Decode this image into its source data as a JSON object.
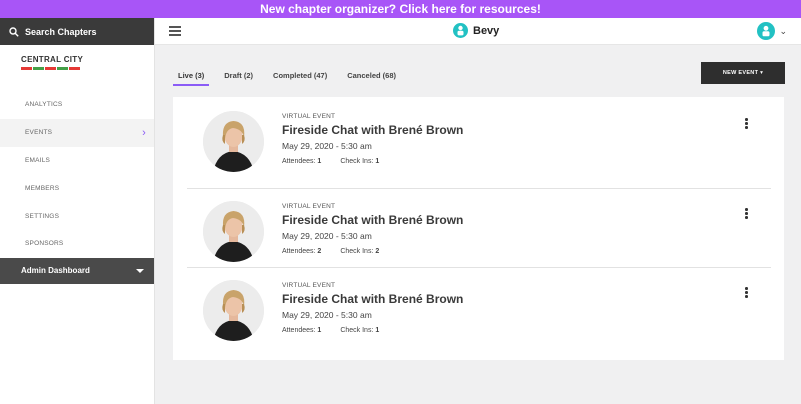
{
  "banner": {
    "text": "New chapter organizer? Click here for resources!"
  },
  "sidebar": {
    "search_label": "Search Chapters",
    "chapter_name": "CENTRAL CITY",
    "chapter_stripe_colors": [
      "#e53935",
      "#43a047",
      "#e53935",
      "#43a047",
      "#e53935"
    ],
    "items": [
      {
        "label": "ANALYTICS"
      },
      {
        "label": "EVENTS",
        "active": true
      },
      {
        "label": "EMAILS"
      },
      {
        "label": "MEMBERS"
      },
      {
        "label": "SETTINGS"
      },
      {
        "label": "SPONSORS"
      }
    ],
    "admin_label": "Admin Dashboard"
  },
  "topbar": {
    "brand": "Bevy",
    "menu_icon": "hamburger-icon",
    "user_icon": "user-avatar-icon"
  },
  "main": {
    "tabs": [
      {
        "label": "Live (3)",
        "active": true
      },
      {
        "label": "Draft (2)"
      },
      {
        "label": "Completed (47)"
      },
      {
        "label": "Canceled (68)"
      }
    ],
    "new_event_label": "NEW EVENT ▾",
    "events": [
      {
        "type": "VIRTUAL EVENT",
        "title": "Fireside Chat with Brené Brown",
        "date": "May 29, 2020 - 5:30 am",
        "attendees_label": "Attendees:",
        "attendees": "1",
        "checkins_label": "Check Ins:",
        "checkins": "1"
      },
      {
        "type": "VIRTUAL EVENT",
        "title": "Fireside Chat with Brené Brown",
        "date": "May 29, 2020 - 5:30 am",
        "attendees_label": "Attendees:",
        "attendees": "2",
        "checkins_label": "Check Ins:",
        "checkins": "2"
      },
      {
        "type": "VIRTUAL EVENT",
        "title": "Fireside Chat with Brené Brown",
        "date": "May 29, 2020 - 5:30 am",
        "attendees_label": "Attendees:",
        "attendees": "1",
        "checkins_label": "Check Ins:",
        "checkins": "1"
      }
    ]
  },
  "colors": {
    "banner": "#a855f7",
    "accent": "#8b5cf6",
    "brand": "#22c1c3",
    "sidebar_dark": "#3a3a3a"
  }
}
